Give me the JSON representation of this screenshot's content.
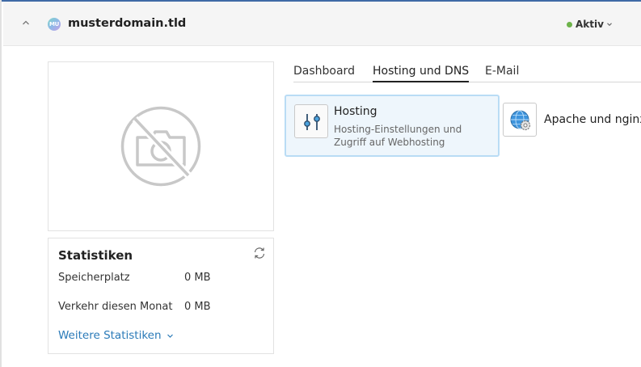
{
  "header": {
    "domain_name": "musterdomain.tld",
    "avatar_initials": "MU",
    "status_label": "Aktiv",
    "status_color": "#6db34a",
    "collapse_icon": "chevron-up-icon",
    "accent_color": "#3f6aa6"
  },
  "preview": {
    "icon": "no-camera-icon"
  },
  "stats": {
    "title": "Statistiken",
    "refresh_icon": "refresh-icon",
    "rows": [
      {
        "label": "Speicherplatz",
        "value": "0 MB"
      },
      {
        "label": "Verkehr diesen Monat",
        "value": "0 MB"
      }
    ],
    "more_link": "Weitere Statistiken",
    "link_color": "#2a7ab8"
  },
  "tabs": [
    {
      "label": "Dashboard",
      "active": false
    },
    {
      "label": "Hosting und DNS",
      "active": true
    },
    {
      "label": "E-Mail",
      "active": false
    }
  ],
  "cards": [
    {
      "title": "Hosting",
      "description": "Hosting-Einstellungen und Zugriff auf Webhosting",
      "icon": "sliders-icon",
      "selected": true
    },
    {
      "title": "Apache und nginx",
      "icon": "globe-gear-icon",
      "selected": false
    }
  ]
}
